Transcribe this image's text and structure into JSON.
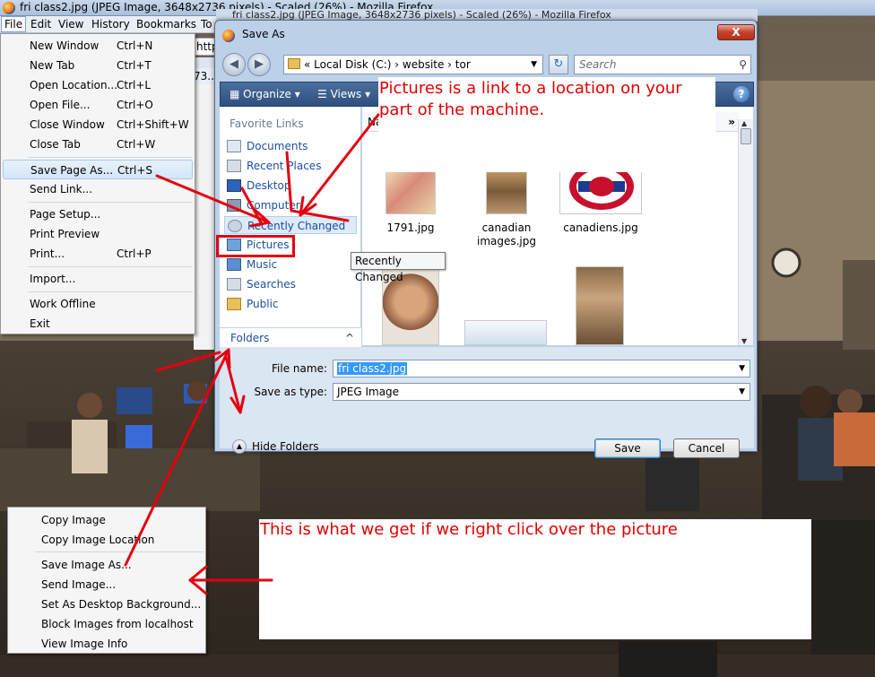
{
  "window": {
    "title": "fri class2.jpg (JPEG Image, 3648x2736 pixels) - Scaled (26%) - Mozilla Firefox",
    "behind_title": "fri class2.jpg (JPEG Image, 3648x2736 pixels) - Scaled (26%) - Mozilla Firefox",
    "url_stub": "http",
    "stub2": "73.."
  },
  "menubar": {
    "items": [
      "File",
      "Edit",
      "View",
      "History",
      "Bookmarks",
      "To"
    ]
  },
  "file_menu": {
    "items": [
      {
        "label": "New Window",
        "shortcut": "Ctrl+N"
      },
      {
        "label": "New Tab",
        "shortcut": "Ctrl+T"
      },
      {
        "label": "Open Location...",
        "shortcut": "Ctrl+L"
      },
      {
        "label": "Open File...",
        "shortcut": "Ctrl+O"
      },
      {
        "label": "Close Window",
        "shortcut": "Ctrl+Shift+W"
      },
      {
        "label": "Close Tab",
        "shortcut": "Ctrl+W"
      },
      {
        "label": "Save Page As...",
        "shortcut": "Ctrl+S"
      },
      {
        "label": "Send Link...",
        "shortcut": ""
      },
      {
        "label": "Page Setup...",
        "shortcut": ""
      },
      {
        "label": "Print Preview",
        "shortcut": ""
      },
      {
        "label": "Print...",
        "shortcut": "Ctrl+P"
      },
      {
        "label": "Import...",
        "shortcut": ""
      },
      {
        "label": "Work Offline",
        "shortcut": ""
      },
      {
        "label": "Exit",
        "shortcut": ""
      }
    ]
  },
  "dialog": {
    "title": "Save As",
    "close": "X",
    "address": {
      "crumbs": "«  Local Disk (C:)  ›  website  ›  tor"
    },
    "search_placeholder": "Search",
    "toolbar": {
      "organize": "Organize",
      "views": "Views",
      "help": "?"
    },
    "favorite_links_heading": "Favorite Links",
    "favorites": [
      "Documents",
      "Recent Places",
      "Desktop",
      "Computer",
      "Recently Changed",
      "Pictures",
      "Music",
      "Searches",
      "Public"
    ],
    "folders_label": "Folders",
    "column_header": "Na",
    "files": [
      {
        "name": "1791.jpg"
      },
      {
        "name": "canadian images.jpg"
      },
      {
        "name": "canadiens.jpg"
      }
    ],
    "file_name_label": "File name:",
    "file_name_value": "fri class2.jpg",
    "save_type_label": "Save as type:",
    "save_type_value": "JPEG Image",
    "hide_folders": "Hide Folders",
    "save_button": "Save",
    "cancel_button": "Cancel",
    "tooltip": "Recently Changed"
  },
  "notes": {
    "pictures_note": "Pictures is a link to a location on your part of the machine.",
    "context_note": "This is what we get if we right click over the picture"
  },
  "context_menu": {
    "items": [
      "Copy Image",
      "Copy Image Location",
      "Save Image As...",
      "Send Image...",
      "Set As Desktop Background...",
      "Block Images from localhost",
      "View Image Info"
    ]
  },
  "colors": {
    "annotation": "#e00000",
    "toolbar": "#2e4f7e",
    "link": "#1b4f9c"
  }
}
